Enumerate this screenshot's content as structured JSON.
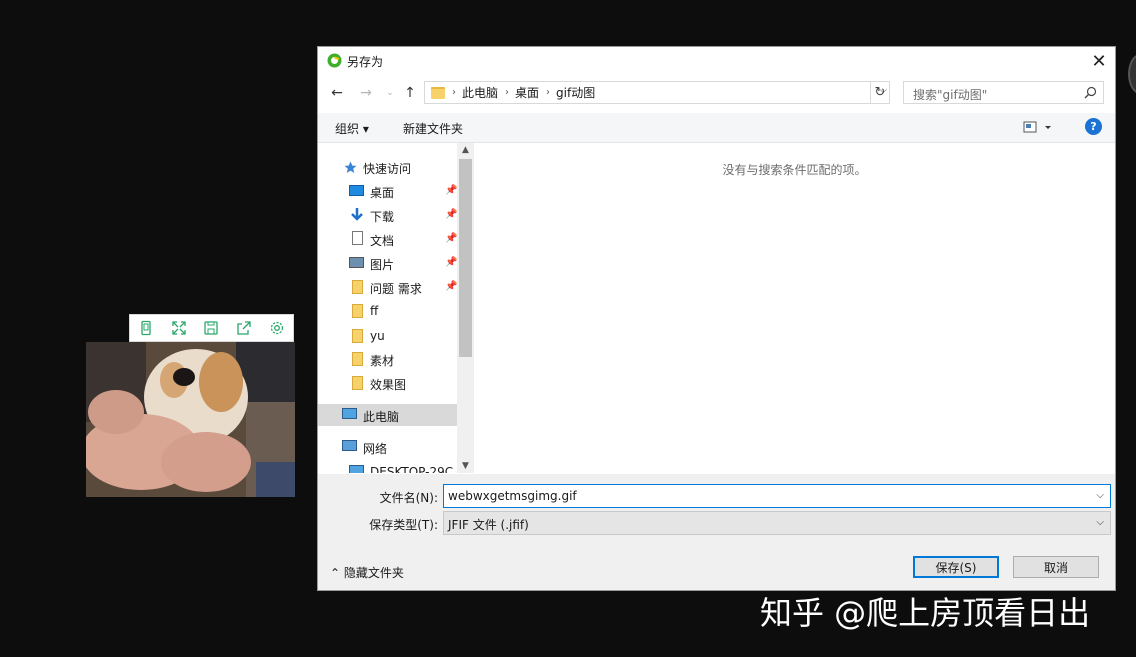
{
  "viewer": {
    "toolbar_icons": [
      "phone-icon",
      "fullscreen-icon",
      "save-icon",
      "share-icon",
      "settings-icon"
    ],
    "photo_alt": "dog photo"
  },
  "dialog": {
    "title": "另存为",
    "close": "✕",
    "breadcrumb": [
      "此电脑",
      "桌面",
      "gif动图"
    ],
    "search_placeholder": "搜索\"gif动图\"",
    "organize": "组织 ▾",
    "new_folder": "新建文件夹",
    "help": "?",
    "empty_message": "没有与搜索条件匹配的项。",
    "nav": {
      "quick_access": "快速访问",
      "items": [
        {
          "label": "桌面",
          "pinned": true,
          "icon": "desktop-icon"
        },
        {
          "label": "下载",
          "pinned": true,
          "icon": "download-icon"
        },
        {
          "label": "文档",
          "pinned": true,
          "icon": "document-icon"
        },
        {
          "label": "图片",
          "pinned": true,
          "icon": "pictures-icon"
        },
        {
          "label": "问题 需求",
          "pinned": true,
          "icon": "folder-icon"
        },
        {
          "label": "ff",
          "pinned": false,
          "icon": "folder-icon"
        },
        {
          "label": "yu",
          "pinned": false,
          "icon": "folder-icon"
        },
        {
          "label": "素材",
          "pinned": false,
          "icon": "folder-icon"
        },
        {
          "label": "效果图",
          "pinned": false,
          "icon": "folder-icon"
        }
      ],
      "this_pc": "此电脑",
      "network": "网络",
      "desktop_host": "DESKTOP-29C"
    },
    "filename_label": "文件名(N):",
    "filename_value": "webwxgetmsgimg.gif",
    "filetype_label": "保存类型(T):",
    "filetype_value": "JFIF 文件 (.jfif)",
    "hide_folders": "隐藏文件夹",
    "save": "保存(S)",
    "cancel": "取消"
  },
  "watermark": "知乎 @爬上房顶看日出",
  "colors": {
    "accent": "#0078d7",
    "help": "#1b73d3",
    "background": "#0d0d0d"
  }
}
